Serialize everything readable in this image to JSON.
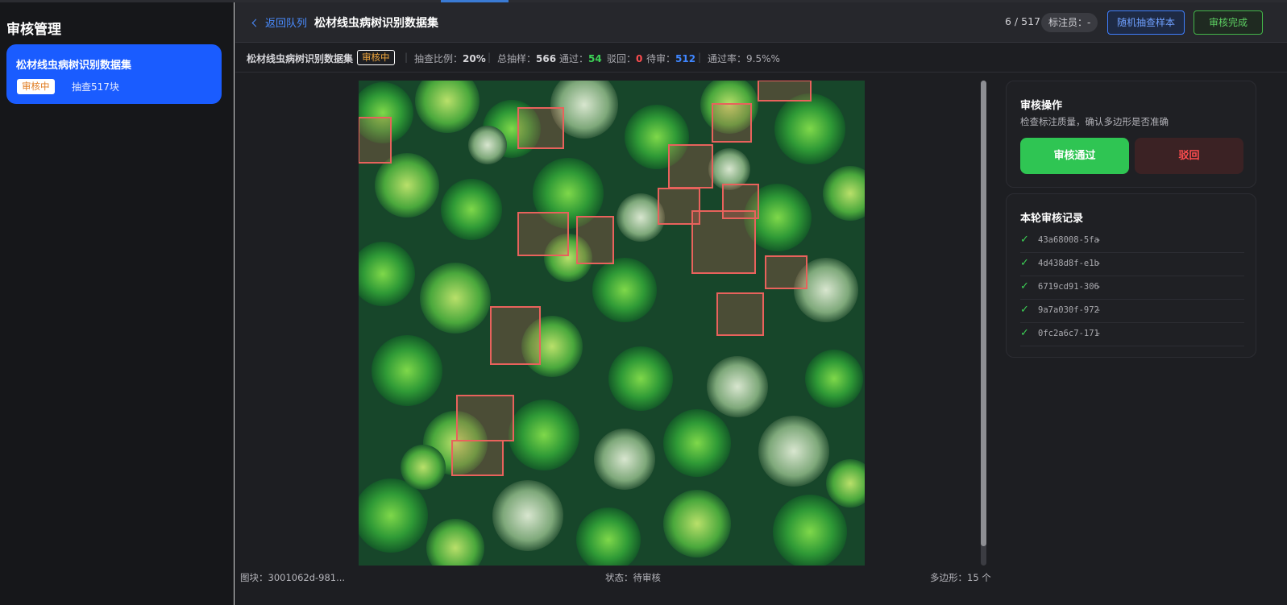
{
  "sidebar": {
    "title": "审核管理",
    "dataset": {
      "name": "松材线虫病树识别数据集",
      "status": "审核中",
      "count": "抽查517块"
    }
  },
  "header": {
    "back_label": "返回队列",
    "title": "松材线虫病树识别数据集",
    "pager": "6 / 517",
    "annotator": "标注员：-",
    "sample_button": "随机抽查样本",
    "done_button": "审核完成"
  },
  "stats": {
    "dataset_name": "松材线虫病树识别数据集",
    "status": "审核中",
    "ratio_label": "抽查比例：",
    "ratio_value": "20%",
    "total_label": "总抽样：",
    "total_value": "566",
    "pass_label": "通过：",
    "pass_value": "54",
    "reject_label": "驳回：",
    "reject_value": "0",
    "pending_label": "待审：",
    "pending_value": "512",
    "rate_label": "通过率：",
    "rate_value": "9.5%%"
  },
  "footer": {
    "tile": "图块：3001062d-981...",
    "status": "状态：待审核",
    "polygons": "多边形：15 个"
  },
  "ops_panel": {
    "title": "审核操作",
    "subtitle": "检查标注质量，确认多边形是否准确",
    "pass_button": "审核通过",
    "reject_button": "驳回"
  },
  "records_panel": {
    "title": "本轮审核记录",
    "items": [
      {
        "id": "43a68008-5fa",
        "value": "-"
      },
      {
        "id": "4d438d8f-e1b",
        "value": "-"
      },
      {
        "id": "6719cd91-306",
        "value": "-"
      },
      {
        "id": "9a7a030f-972",
        "value": "-"
      },
      {
        "id": "0fc2a6c7-171",
        "value": "-"
      }
    ]
  },
  "colors": {
    "accent_blue": "#1a5cff",
    "pass_green": "#2fc553",
    "reject_red": "#ff4d4f",
    "annotation_box": "#e8625c"
  }
}
